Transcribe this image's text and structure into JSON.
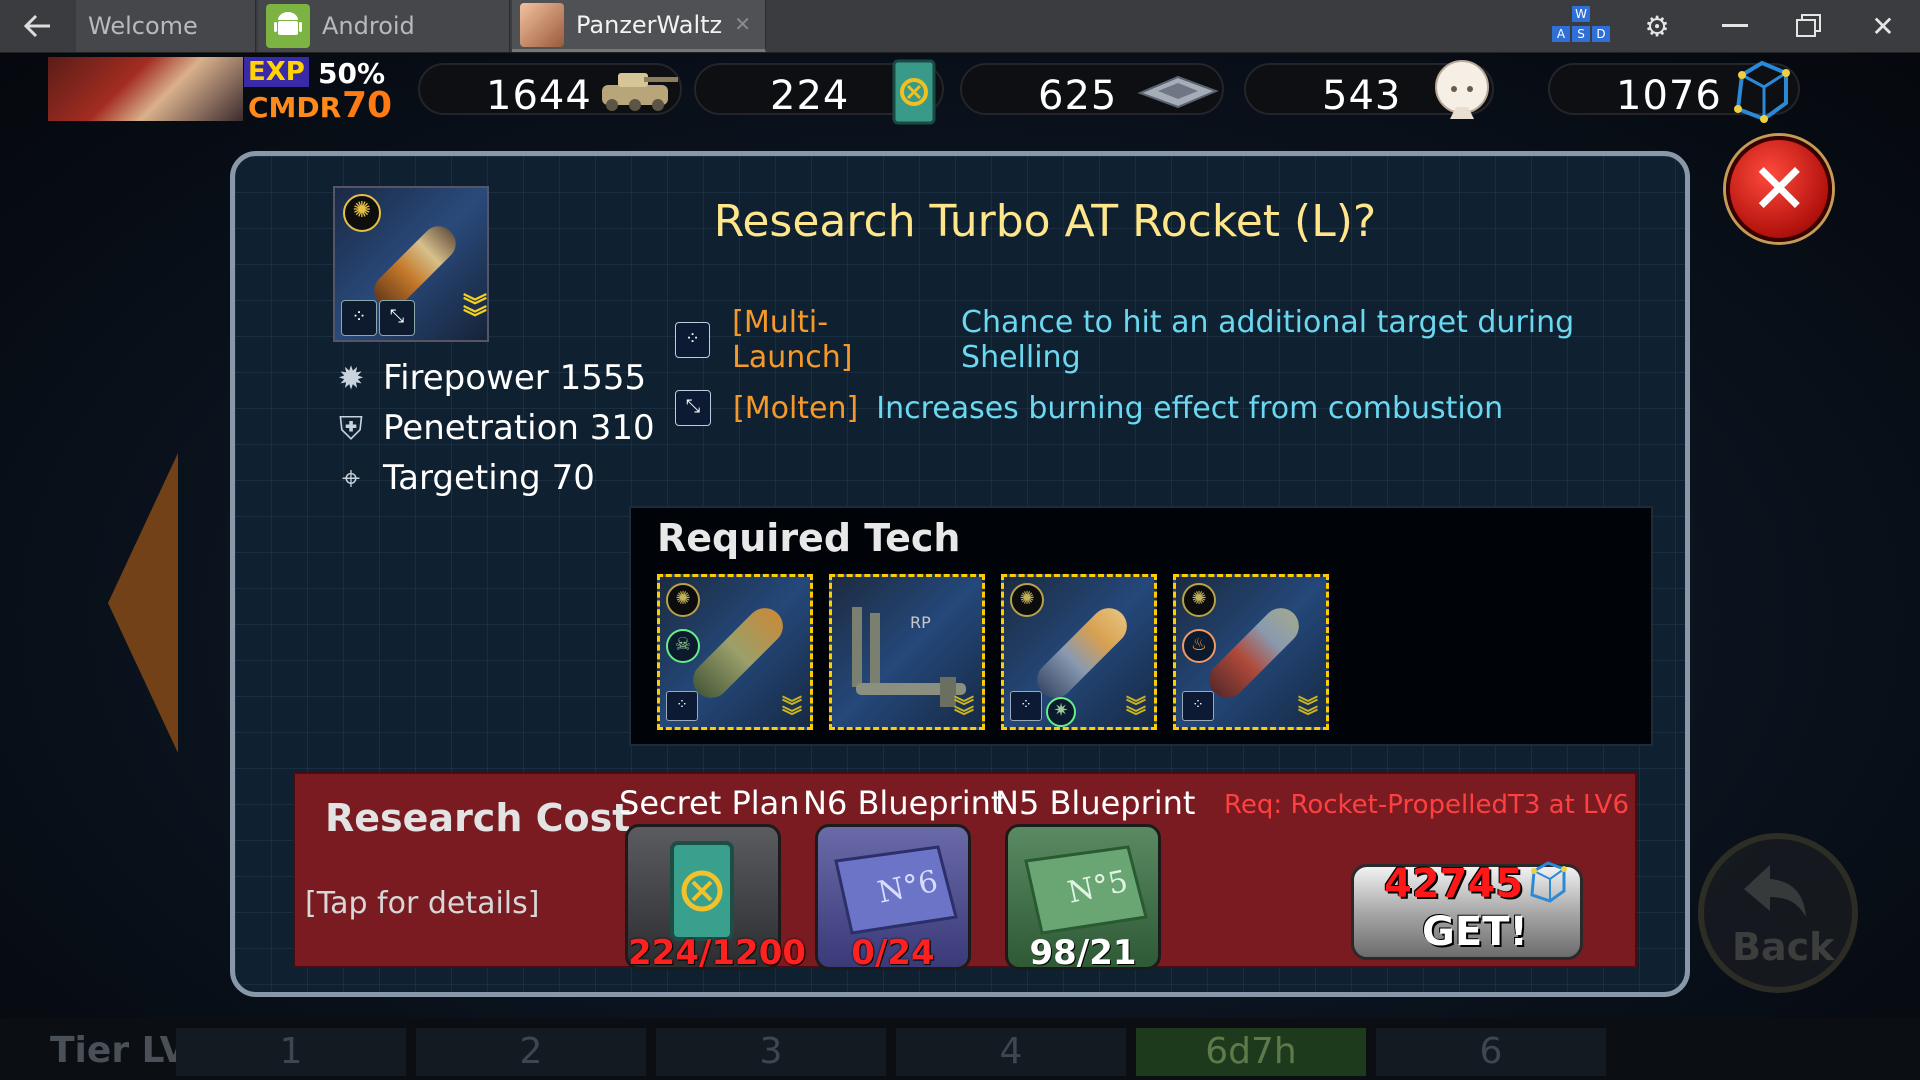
{
  "window": {
    "tabs": [
      {
        "label": "Welcome",
        "active": false
      },
      {
        "label": "Android",
        "active": false
      },
      {
        "label": "PanzerWaltz",
        "active": true
      }
    ],
    "keymap_keys": [
      "W",
      "A",
      "S",
      "D"
    ],
    "icons": {
      "back": "back-arrow-icon",
      "settings": "gear-icon",
      "minimize": "minimize-icon",
      "restore": "restore-icon",
      "close": "close-icon"
    }
  },
  "player": {
    "exp_label": "EXP",
    "exp_value": "50%",
    "cmdr_label": "CMDR",
    "cmdr_level": "70"
  },
  "resources": [
    {
      "value": "1644",
      "icon": "tank-icon"
    },
    {
      "value": "224",
      "icon": "secret-plan-icon"
    },
    {
      "value": "625",
      "icon": "chip-icon"
    },
    {
      "value": "543",
      "icon": "doll-icon"
    },
    {
      "value": "1076",
      "icon": "cube-icon"
    }
  ],
  "modal": {
    "title": "Research Turbo AT Rocket (L)?",
    "stats": [
      {
        "label": "Firepower 1555",
        "icon": "firepower-icon"
      },
      {
        "label": "Penetration 310",
        "icon": "penetration-icon"
      },
      {
        "label": "Targeting 70",
        "icon": "crosshair-icon"
      }
    ],
    "traits": [
      {
        "name": "[Multi-Launch]",
        "desc": "Chance to hit an additional target during Shelling",
        "icon": "multi-launch-icon"
      },
      {
        "name": "[Molten]",
        "desc": "Increases burning effect from combustion",
        "icon": "molten-icon"
      }
    ],
    "required_tech": {
      "title": "Required Tech",
      "items": [
        {
          "icon": "rocket-skull-icon"
        },
        {
          "icon": "rp-launcher-icon",
          "label": "RP"
        },
        {
          "icon": "rocket-blue-icon"
        },
        {
          "icon": "rocket-fire-icon"
        }
      ]
    },
    "research_cost": {
      "title": "Research Cost",
      "tap_hint": "[Tap for details]",
      "requirement": "Req: Rocket-PropelledT3 at LV6",
      "items": [
        {
          "label": "Secret Plan",
          "count": "224/1200",
          "status": "insufficient"
        },
        {
          "label": "N6 Blueprint",
          "count": "0/24",
          "status": "insufficient"
        },
        {
          "label": "N5 Blueprint",
          "count": "98/21",
          "status": "sufficient"
        }
      ],
      "get_price": "42745",
      "get_label": "GET!"
    }
  },
  "bottom": {
    "tier_label": "Tier LVL",
    "tiers": [
      "1",
      "2",
      "3",
      "4",
      "6d7h",
      "6"
    ],
    "back_label": "Back"
  },
  "colors": {
    "accent_title": "#ffe68a",
    "trait_name": "#f59a2a",
    "trait_desc": "#6ad8f0",
    "cost_bg": "#7a1b21",
    "insufficient": "#ff2020"
  }
}
